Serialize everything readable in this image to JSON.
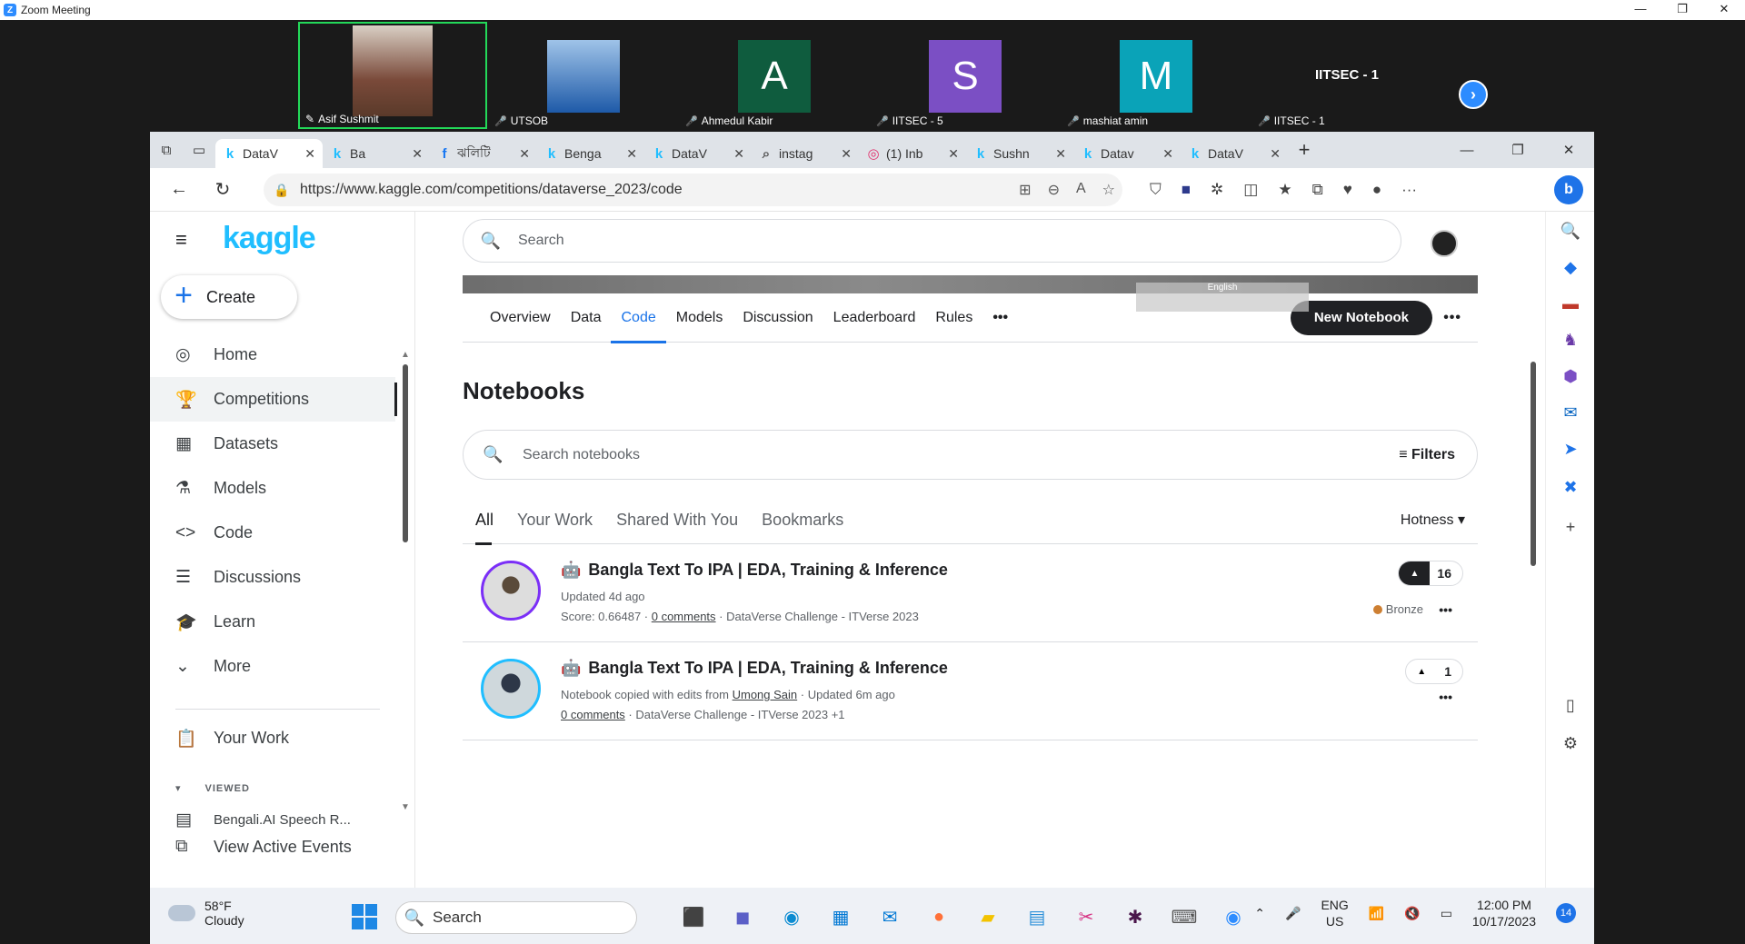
{
  "zoom": {
    "title": "Zoom Meeting",
    "participants": [
      {
        "name": "Asif Sushmit",
        "initial": "",
        "color": "#5a3a2a"
      },
      {
        "name": "UTSOB",
        "initial": "",
        "color": "#1e5aa8"
      },
      {
        "name": "Ahmedul Kabir",
        "initial": "A",
        "color": "#0f5c3e"
      },
      {
        "name": "IITSEC - 5",
        "initial": "S",
        "color": "#7b4fc4"
      },
      {
        "name": "mashiat amin",
        "initial": "M",
        "color": "#0aa3b8"
      },
      {
        "name": "IITSEC - 1",
        "initial": "",
        "big": "IITSEC - 1",
        "color": "#1a1a1a"
      }
    ]
  },
  "browser": {
    "tabs": [
      {
        "fav": "k",
        "title": "DataV",
        "color": "#20beff"
      },
      {
        "fav": "k",
        "title": "Ba",
        "color": "#20beff"
      },
      {
        "fav": "f",
        "title": "ঝলিটি",
        "color": "#1877f2"
      },
      {
        "fav": "k",
        "title": "Benga",
        "color": "#20beff"
      },
      {
        "fav": "k",
        "title": "DataV",
        "color": "#20beff"
      },
      {
        "fav": "⌕",
        "title": "instag",
        "color": "#555"
      },
      {
        "fav": "◎",
        "title": "(1) Inb",
        "color": "#e1306c"
      },
      {
        "fav": "k",
        "title": "Sushn",
        "color": "#20beff"
      },
      {
        "fav": "k",
        "title": "Datav",
        "color": "#20beff"
      },
      {
        "fav": "k",
        "title": "DataV",
        "color": "#20beff"
      }
    ],
    "url": "https://www.kaggle.com/competitions/dataverse_2023/code",
    "lang": "English"
  },
  "kaggle": {
    "logo": "kaggle",
    "create": "Create",
    "menu": [
      {
        "icon": "◎",
        "label": "Home"
      },
      {
        "icon": "🏆",
        "label": "Competitions"
      },
      {
        "icon": "▦",
        "label": "Datasets"
      },
      {
        "icon": "⚗",
        "label": "Models"
      },
      {
        "icon": "<>",
        "label": "Code"
      },
      {
        "icon": "☰",
        "label": "Discussions"
      },
      {
        "icon": "🎓",
        "label": "Learn"
      },
      {
        "icon": "⌄",
        "label": "More"
      }
    ],
    "your_work": "Your Work",
    "viewed_label": "VIEWED",
    "viewed_item": "Bengali.AI Speech R...",
    "view_events": "View Active Events",
    "search_placeholder": "Search",
    "subtabs": [
      "Overview",
      "Data",
      "Code",
      "Models",
      "Discussion",
      "Leaderboard",
      "Rules"
    ],
    "new_notebook": "New Notebook",
    "heading": "Notebooks",
    "search_nb_placeholder": "Search notebooks",
    "filters": "Filters",
    "filter_tabs": [
      "All",
      "Your Work",
      "Shared With You",
      "Bookmarks"
    ],
    "sort": "Hotness",
    "notebooks": [
      {
        "title": "Bangla Text To IPA | EDA, Training & Inference",
        "line1": "Updated 4d ago",
        "score": "Score: 0.66487 · ",
        "comments": "0 comments",
        "tail": " · DataVerse Challenge - ITVerse 2023",
        "votes": "16",
        "medal": "Bronze"
      },
      {
        "title": "Bangla Text To IPA | EDA, Training & Inference",
        "line1_a": "Notebook copied with edits from ",
        "line1_user": "Umong Sain",
        "line1_b": " · Updated 6m ago",
        "comments": "0 comments",
        "tail": " · DataVerse Challenge - ITVerse 2023 +1",
        "votes": "1"
      }
    ]
  },
  "taskbar": {
    "temp": "58°F",
    "weather": "Cloudy",
    "search": "Search",
    "lang1": "ENG",
    "lang2": "US",
    "time": "12:00 PM",
    "date": "10/17/2023",
    "notif": "14"
  }
}
